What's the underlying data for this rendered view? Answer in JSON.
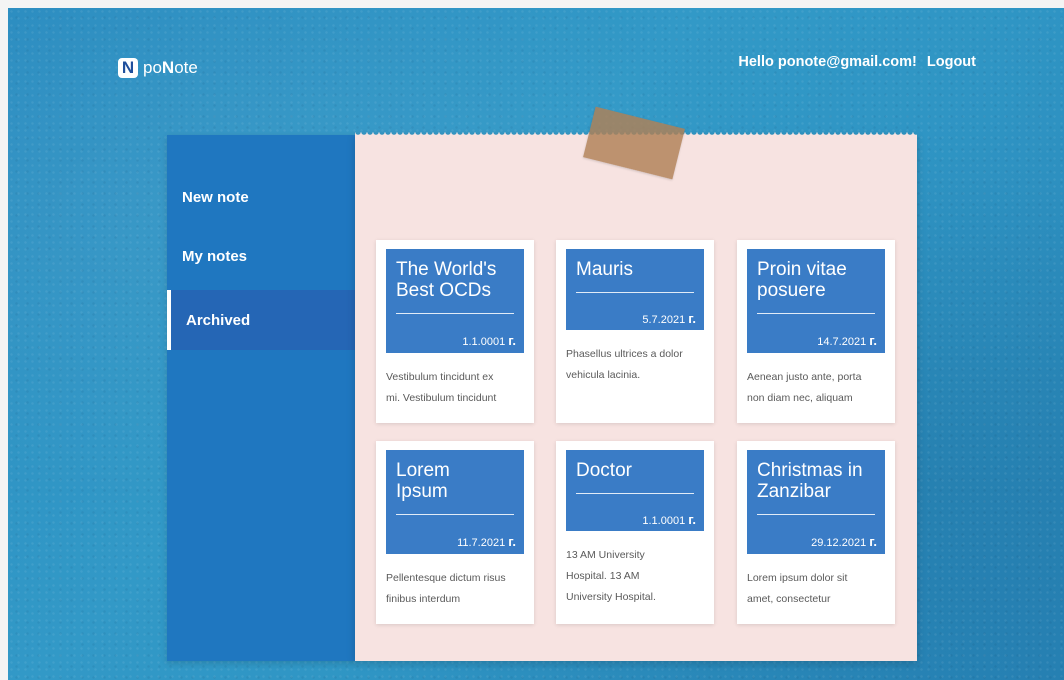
{
  "header": {
    "logo_mark": "N",
    "logo_prefix": "po",
    "logo_bold": "N",
    "logo_suffix": "ote",
    "greeting": "Hello ponote@gmail.com!",
    "logout": "Logout"
  },
  "sidebar": {
    "items": [
      {
        "label": "New note",
        "active": false
      },
      {
        "label": "My notes",
        "active": false
      },
      {
        "label": "Archived",
        "active": true
      }
    ]
  },
  "notes": [
    {
      "title_lines": [
        "The World's",
        "Best OCDs"
      ],
      "date": "1.1.0001",
      "suffix": "г.",
      "body_lines": [
        "Vestibulum tincidunt ex",
        "mi. Vestibulum tincidunt"
      ]
    },
    {
      "title_lines": [
        "Mauris"
      ],
      "date": "5.7.2021",
      "suffix": "г.",
      "body_lines": [
        "Phasellus ultrices a dolor",
        "vehicula lacinia."
      ]
    },
    {
      "title_lines": [
        "Proin vitae",
        "posuere"
      ],
      "date": "14.7.2021",
      "suffix": "г.",
      "body_lines": [
        "Aenean justo ante, porta",
        "non diam nec, aliquam"
      ]
    },
    {
      "title_lines": [
        "Lorem",
        "Ipsum"
      ],
      "date": "11.7.2021",
      "suffix": "г.",
      "body_lines": [
        "Pellentesque dictum risus",
        "finibus interdum"
      ]
    },
    {
      "title_lines": [
        "Doctor"
      ],
      "date": "1.1.0001",
      "suffix": "г.",
      "body_lines": [
        "13 AM University",
        "Hospital. 13 AM",
        "University Hospital."
      ]
    },
    {
      "title_lines": [
        "Christmas in",
        "Zanzibar"
      ],
      "date": "29.12.2021",
      "suffix": "г.",
      "body_lines": [
        "Lorem ipsum dolor sit",
        "amet, consectetur"
      ]
    }
  ],
  "colors": {
    "background": "#2f95c4",
    "sidebar": "#1f77c0",
    "sidebar_active": "#2566b5",
    "paper": "#f7e3e1",
    "card_header": "#3a7cc6",
    "tape": "#b08056"
  }
}
